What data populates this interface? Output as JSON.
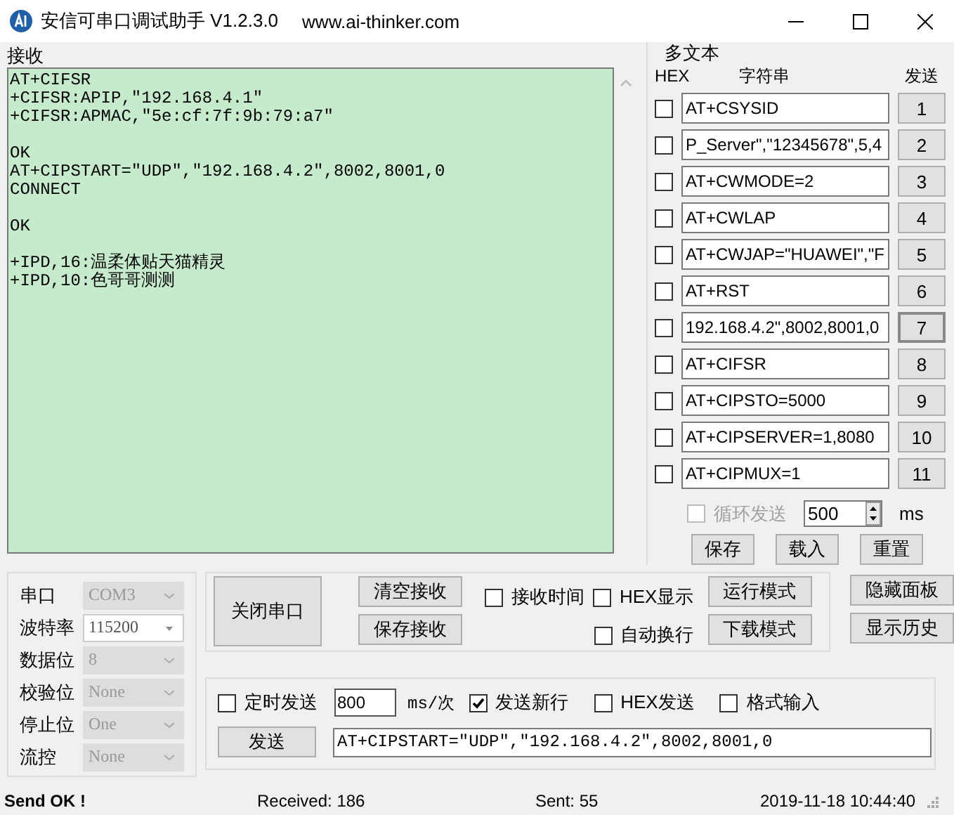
{
  "window": {
    "title": "安信可串口调试助手 V1.2.3.0",
    "url": "www.ai-thinker.com"
  },
  "receive": {
    "label": "接收",
    "blocks": [
      [
        "AT+CIFSR",
        "+CIFSR:APIP,\"192.168.4.1\"",
        "+CIFSR:APMAC,\"5e:cf:7f:9b:79:a7\""
      ],
      [
        "OK",
        "AT+CIPSTART=\"UDP\",\"192.168.4.2\",8002,8001,0",
        "CONNECT"
      ],
      [
        "OK"
      ],
      [
        "+IPD,16:温柔体贴天猫精灵",
        "+IPD,10:色哥哥测测"
      ]
    ]
  },
  "multi_text": {
    "label": "多文本",
    "col_hex": "HEX",
    "col_string": "字符串",
    "col_send": "发送",
    "rows": [
      {
        "hex": false,
        "value": "AT+CSYSID",
        "button": "1",
        "selected": false
      },
      {
        "hex": false,
        "value": "P_Server\",\"12345678\",5,4",
        "button": "2",
        "selected": false
      },
      {
        "hex": false,
        "value": "AT+CWMODE=2",
        "button": "3",
        "selected": false
      },
      {
        "hex": false,
        "value": "AT+CWLAP",
        "button": "4",
        "selected": false
      },
      {
        "hex": false,
        "value": "AT+CWJAP=\"HUAWEI\",\"F",
        "button": "5",
        "selected": false
      },
      {
        "hex": false,
        "value": "AT+RST",
        "button": "6",
        "selected": false
      },
      {
        "hex": false,
        "value": "192.168.4.2\",8002,8001,0",
        "button": "7",
        "selected": true
      },
      {
        "hex": false,
        "value": "AT+CIFSR",
        "button": "8",
        "selected": false
      },
      {
        "hex": false,
        "value": "AT+CIPSTO=5000",
        "button": "9",
        "selected": false
      },
      {
        "hex": false,
        "value": "AT+CIPSERVER=1,8080",
        "button": "10",
        "selected": false
      },
      {
        "hex": false,
        "value": "AT+CIPMUX=1",
        "button": "11",
        "selected": false
      }
    ],
    "loop": {
      "label": "循环发送",
      "checked": false,
      "disabled": true
    },
    "interval": "500",
    "unit": "ms",
    "buttons": [
      "保存",
      "载入",
      "重置"
    ]
  },
  "serial": [
    {
      "label": "串口",
      "value": "COM3",
      "disabled": true
    },
    {
      "label": "波特率",
      "value": "115200",
      "disabled": false
    },
    {
      "label": "数据位",
      "value": "8",
      "disabled": true
    },
    {
      "label": "校验位",
      "value": "None",
      "disabled": true
    },
    {
      "label": "停止位",
      "value": "One",
      "disabled": true
    },
    {
      "label": "流控",
      "value": "None",
      "disabled": true
    }
  ],
  "port_button": "关闭串口",
  "receive_buttons": [
    "清空接收",
    "保存接收"
  ],
  "receive_options": [
    {
      "label": "接收时间",
      "checked": false
    },
    {
      "label": "HEX显示",
      "checked": false
    },
    {
      "label": "自动换行",
      "checked": false
    }
  ],
  "mode_buttons": [
    "运行模式",
    "下载模式"
  ],
  "panel_buttons": [
    "隐藏面板",
    "显示历史"
  ],
  "send": {
    "timed": {
      "label": "定时发送",
      "checked": false
    },
    "interval": "800",
    "unit": "ms/次",
    "options": [
      {
        "label": "发送新行",
        "checked": true
      },
      {
        "label": "HEX发送",
        "checked": false
      },
      {
        "label": "格式输入",
        "checked": false
      }
    ],
    "button": "发送",
    "value": "AT+CIPSTART=\"UDP\",\"192.168.4.2\",8002,8001,0"
  },
  "status_bar": {
    "message": "Send OK !",
    "received": "Received: 186",
    "sent": "Sent: 55",
    "time": "2019-11-18 10:44:40"
  }
}
